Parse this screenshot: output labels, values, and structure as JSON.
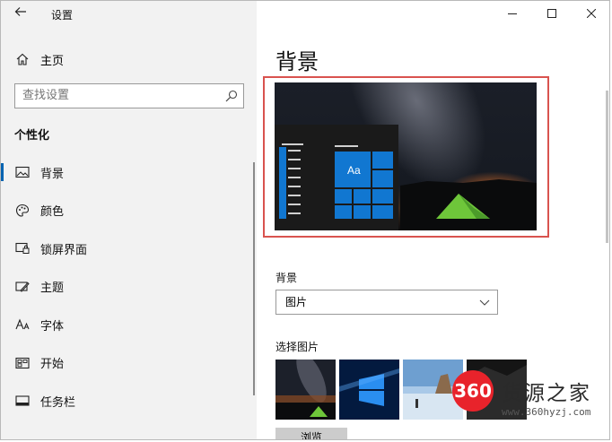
{
  "window": {
    "title": "设置",
    "controls": [
      "minimize",
      "maximize",
      "close"
    ]
  },
  "sidebar": {
    "home_label": "主页",
    "search_placeholder": "查找设置",
    "section_title": "个性化",
    "items": [
      {
        "label": "背景",
        "icon": "image-icon",
        "active": true
      },
      {
        "label": "颜色",
        "icon": "palette-icon",
        "active": false
      },
      {
        "label": "锁屏界面",
        "icon": "lock-screen-icon",
        "active": false
      },
      {
        "label": "主题",
        "icon": "theme-icon",
        "active": false
      },
      {
        "label": "字体",
        "icon": "font-icon",
        "active": false
      },
      {
        "label": "开始",
        "icon": "start-icon",
        "active": false
      },
      {
        "label": "任务栏",
        "icon": "taskbar-icon",
        "active": false
      }
    ]
  },
  "main": {
    "page_title": "背景",
    "preview": {
      "tile_text": "Aa"
    },
    "background_label": "背景",
    "background_value": "图片",
    "choose_picture_label": "选择图片",
    "thumbnails": [
      "galaxy-tent",
      "windows-10-blue",
      "beach-sunset",
      "dark-rocks"
    ],
    "browse_label": "浏览"
  },
  "watermark": {
    "logo_text": "360",
    "name": "货源之家",
    "url": "www.360hyzj.com"
  },
  "colors": {
    "accent": "#0078d7",
    "active_indicator": "#0063b1",
    "highlight_outline": "#d9534f",
    "sidebar_bg": "#f2f2f2"
  }
}
